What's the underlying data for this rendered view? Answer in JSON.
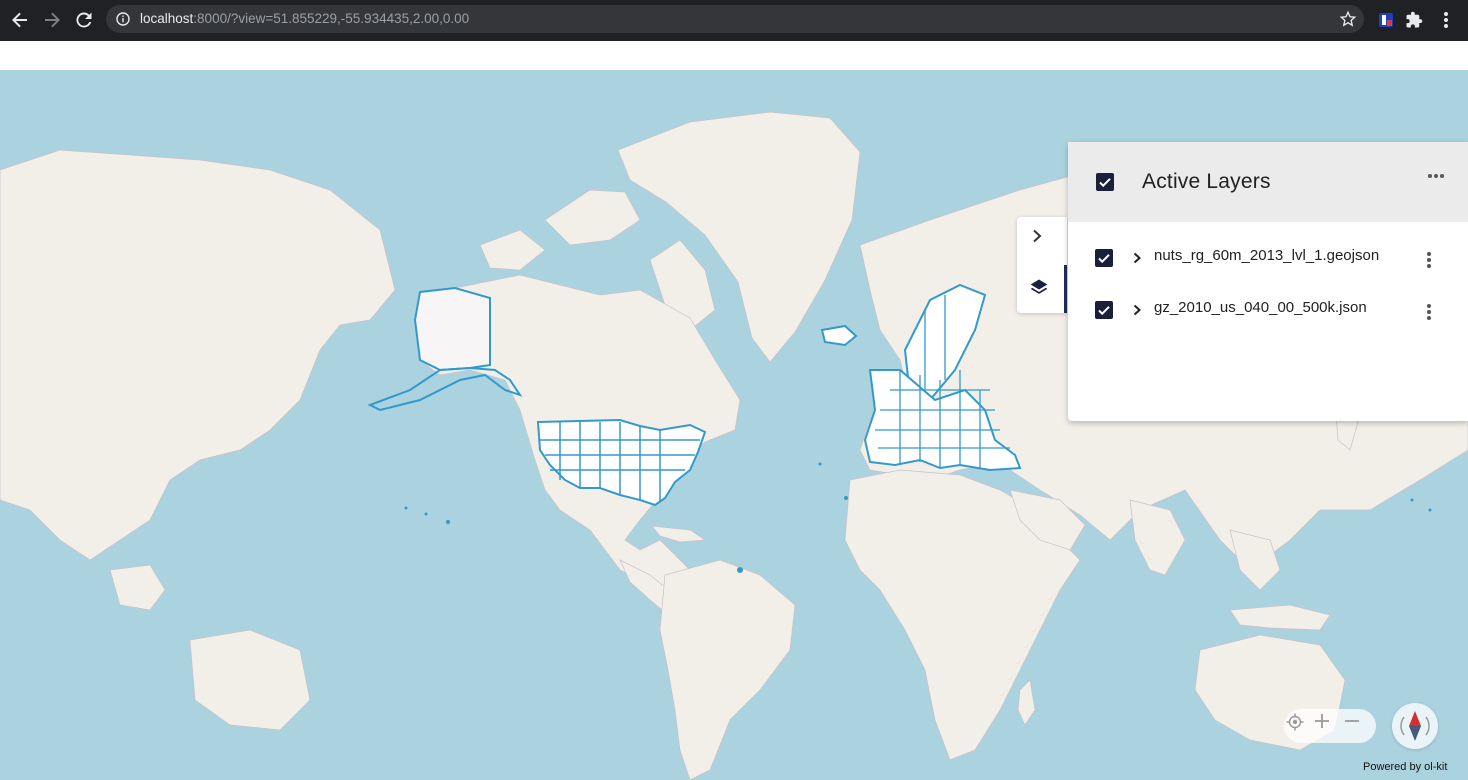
{
  "browser": {
    "url_host": "localhost",
    "url_rest": ":8000/?view=51.855229,-55.934435,2.00,0.00",
    "icons": [
      "back-arrow-icon",
      "forward-arrow-icon",
      "reload-icon",
      "info-icon",
      "star-icon",
      "extension-shield-icon",
      "puzzle-icon",
      "kebab-menu-icon"
    ]
  },
  "layers_panel": {
    "title": "Active Layers",
    "layers": [
      {
        "name": "nuts_rg_60m_2013_lvl_1.geojson",
        "checked": true
      },
      {
        "name": "gz_2010_us_040_00_500k.json",
        "checked": true
      }
    ]
  },
  "map_controls": {
    "icons": [
      "locate-icon",
      "zoom-in-icon",
      "zoom-out-icon",
      "compass-icon"
    ]
  },
  "footer": {
    "powered_by": "Powered by ol-kit"
  },
  "colors": {
    "water": "#aad3df",
    "land": "#f2efe9",
    "feature_stroke": "#3399cc",
    "accent": "#1a1f3d"
  }
}
